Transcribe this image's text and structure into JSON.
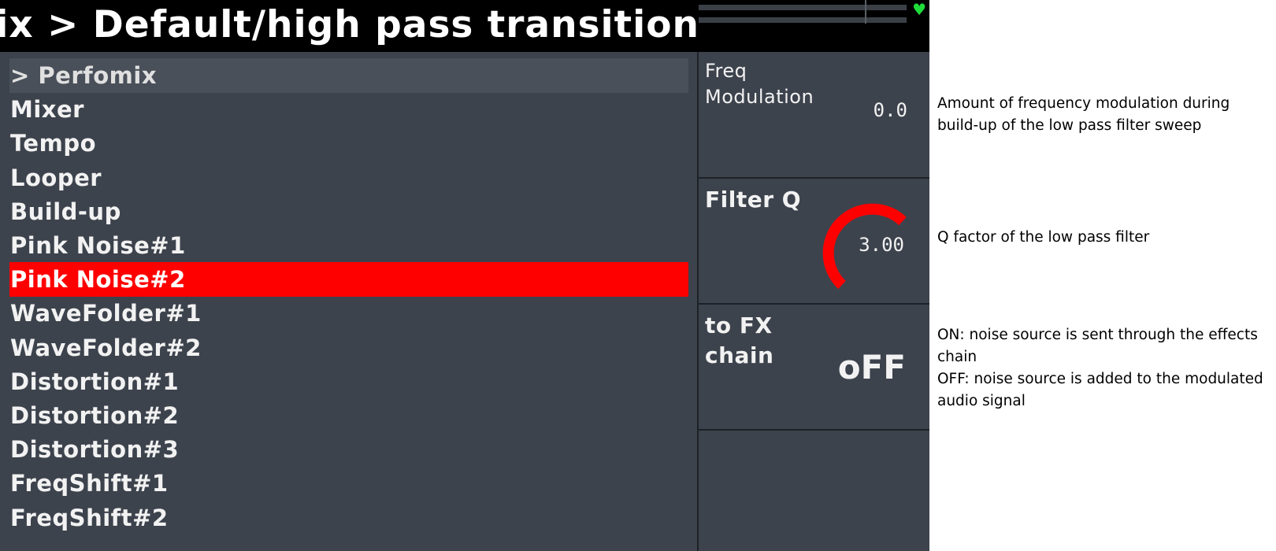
{
  "title": "nix > Default/high pass transition",
  "status": {
    "heart_color": "#1fdc3a"
  },
  "list": {
    "items": [
      {
        "label": "> Perfomix",
        "state": "header"
      },
      {
        "label": "Mixer",
        "state": "normal"
      },
      {
        "label": "Tempo",
        "state": "normal"
      },
      {
        "label": "Looper",
        "state": "normal"
      },
      {
        "label": "Build-up",
        "state": "normal"
      },
      {
        "label": "Pink Noise#1",
        "state": "normal"
      },
      {
        "label": "Pink Noise#2",
        "state": "selected"
      },
      {
        "label": "WaveFolder#1",
        "state": "normal"
      },
      {
        "label": "WaveFolder#2",
        "state": "normal"
      },
      {
        "label": "Distortion#1",
        "state": "normal"
      },
      {
        "label": "Distortion#2",
        "state": "normal"
      },
      {
        "label": "Distortion#3",
        "state": "normal"
      },
      {
        "label": "FreqShift#1",
        "state": "normal"
      },
      {
        "label": "FreqShift#2",
        "state": "normal"
      }
    ],
    "selected_color": "#ff0000"
  },
  "params": {
    "freq_modulation": {
      "label": "Freq Modulation",
      "value": "0.0"
    },
    "filter_q": {
      "label": "Filter Q",
      "value": "3.00",
      "knob_color": "#ff0000"
    },
    "to_fx_chain": {
      "label": "to FX chain",
      "value": "oFF"
    }
  },
  "annotations": {
    "freq": "Amount of frequency modulation during build-up of the low pass filter sweep",
    "q": "Q factor of the low pass filter",
    "fx_line1": "ON: noise source is sent through the effects chain",
    "fx_line2": "OFF: noise source is added to the modulated audio signal"
  }
}
